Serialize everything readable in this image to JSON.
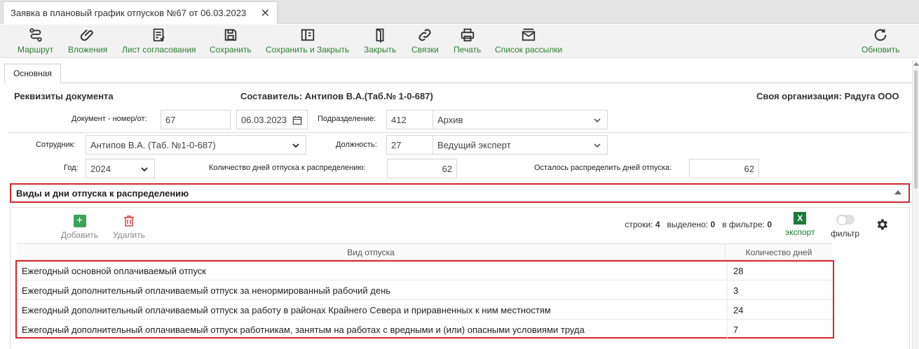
{
  "window": {
    "tab_title": "Заявка в плановый график отпусков №67 от 06.03.2023",
    "close_glyph": "✕"
  },
  "toolbar": {
    "route": "Маршрут",
    "attachments": "Вложения",
    "approval_sheet": "Лист согласования",
    "save": "Сохранить",
    "save_close": "Сохранить и Закрыть",
    "close": "Закрыть",
    "links": "Связки",
    "print": "Печать",
    "mailing": "Список рассылки",
    "refresh": "Обновить"
  },
  "tabs": {
    "main": "Основная"
  },
  "header": {
    "requisites": "Реквизиты документа",
    "author": "Составитель: Антипов В.А.(Таб.№ 1-0-687)",
    "org": "Своя организация: Радуга ООО"
  },
  "form": {
    "doc_number_label": "Документ - номер/от:",
    "doc_number": "67",
    "doc_date": "06.03.2023",
    "department_label": "Подразделение:",
    "department_code": "412",
    "department_name": "Архив",
    "employee_label": "Сотрудник:",
    "employee": "Антипов В.А. (Таб. №1-0-687)",
    "position_label": "Должность:",
    "position_code": "27",
    "position_name": "Ведущий эксперт",
    "year_label": "Год:",
    "year": "2024",
    "days_total_label": "Количество дней отпуска к распределению:",
    "days_total": "62",
    "days_left_label": "Осталось распределить дней отпуска:",
    "days_left": "62"
  },
  "section": {
    "title": "Виды и дни отпуска к распределению"
  },
  "grid": {
    "add": "Добавить",
    "delete": "Удалить",
    "rows_label": "строки:",
    "rows_value": "4",
    "selected_label": "выделено:",
    "selected_value": "0",
    "filtered_label": "в фильтре:",
    "filtered_value": "0",
    "export": "экспорт",
    "export_glyph": "X",
    "filter": "фильтр",
    "col_type": "Вид отпуска",
    "col_days": "Количество дней",
    "rows": [
      {
        "type": "Ежегодный основной оплачиваемый отпуск",
        "days": "28"
      },
      {
        "type": "Ежегодный дополнительный оплачиваемый отпуск за ненормированный рабочий день",
        "days": "3"
      },
      {
        "type": "Ежегодный дополнительный оплачиваемый отпуск за работу в районах Крайнего Севера и приравненных к ним местностям",
        "days": "24"
      },
      {
        "type": "Ежегодный дополнительный оплачиваемый отпуск работникам, занятым на работах с вредными и (или) опасными условиями труда",
        "days": "7"
      }
    ]
  },
  "colors": {
    "accent_green": "#2e7d32",
    "highlight_red": "#d7262e",
    "excel_green": "#1d7a3d"
  }
}
